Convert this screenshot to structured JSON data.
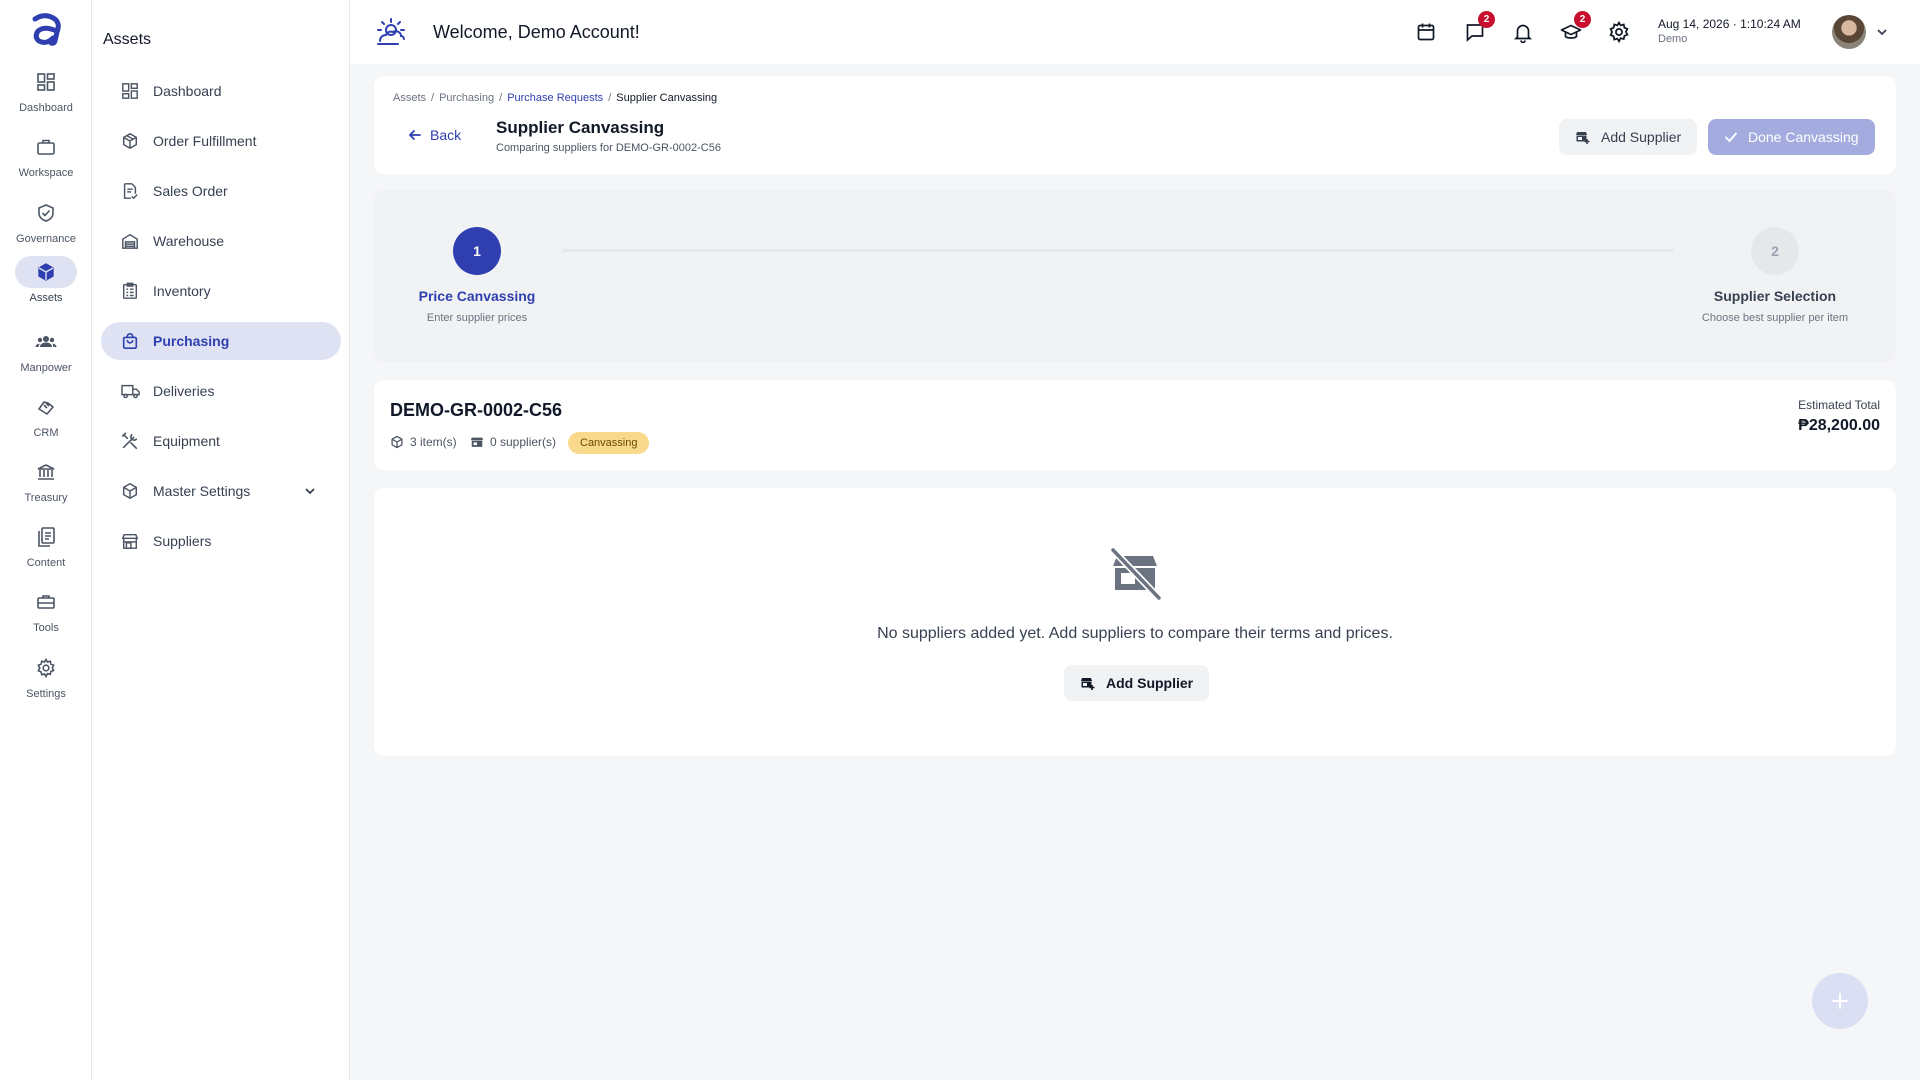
{
  "rail": {
    "items": [
      {
        "label": "Dashboard",
        "icon": "dashboard-grid-icon"
      },
      {
        "label": "Workspace",
        "icon": "briefcase-icon"
      },
      {
        "label": "Governance",
        "icon": "shield-check-icon"
      },
      {
        "label": "Assets",
        "icon": "cube-icon"
      },
      {
        "label": "Manpower",
        "icon": "people-icon"
      },
      {
        "label": "CRM",
        "icon": "handshake-icon"
      },
      {
        "label": "Treasury",
        "icon": "bank-icon"
      },
      {
        "label": "Content",
        "icon": "documents-icon"
      },
      {
        "label": "Tools",
        "icon": "toolbox-icon"
      },
      {
        "label": "Settings",
        "icon": "gear-icon"
      }
    ],
    "active": "Assets"
  },
  "sidebar": {
    "title": "Assets",
    "items": [
      {
        "label": "Dashboard"
      },
      {
        "label": "Order Fulfillment"
      },
      {
        "label": "Sales Order"
      },
      {
        "label": "Warehouse"
      },
      {
        "label": "Inventory"
      },
      {
        "label": "Purchasing"
      },
      {
        "label": "Deliveries"
      },
      {
        "label": "Equipment"
      },
      {
        "label": "Master Settings"
      },
      {
        "label": "Suppliers"
      }
    ],
    "active": "Purchasing"
  },
  "header": {
    "welcome": "Welcome, Demo Account!",
    "messages_badge": "2",
    "learning_badge": "2",
    "date": "Aug 14, 2026",
    "separator": "·",
    "time": "1:10:24 AM",
    "user": "Demo"
  },
  "breadcrumb": {
    "items": [
      "Assets",
      "Purchasing",
      "Purchase Requests",
      "Supplier Canvassing"
    ],
    "separator": "/"
  },
  "page": {
    "back_label": "Back",
    "title": "Supplier Canvassing",
    "subtitle": "Comparing suppliers for DEMO-GR-0002-C56",
    "add_supplier_label": "Add Supplier",
    "done_label": "Done Canvassing"
  },
  "steps": [
    {
      "number": "1",
      "title": "Price Canvassing",
      "subtitle": "Enter supplier prices",
      "state": "active"
    },
    {
      "number": "2",
      "title": "Supplier Selection",
      "subtitle": "Choose best supplier per item",
      "state": "pending"
    }
  ],
  "request": {
    "id": "DEMO-GR-0002-C56",
    "items_count": "3 item(s)",
    "suppliers_count": "0 supplier(s)",
    "status": "Canvassing",
    "estimated_label": "Estimated Total",
    "estimated_value": "₱28,200.00"
  },
  "empty_state": {
    "message": "No suppliers added yet. Add suppliers to compare their terms and prices.",
    "button_label": "Add Supplier"
  },
  "colors": {
    "accent": "#2f3fb0",
    "active_bg": "#dfe2f2",
    "status_badge": "#f9d98c",
    "notification": "#c8102e"
  }
}
